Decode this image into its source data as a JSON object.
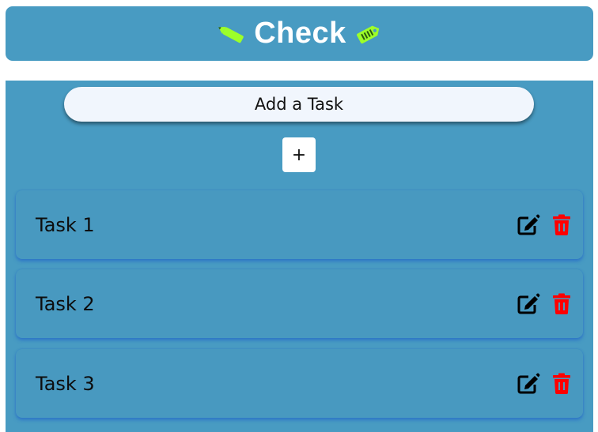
{
  "header": {
    "title": "Check",
    "left_icon": "pencil-icon",
    "right_icon": "tag-icon",
    "icon_color": "#9dff2a"
  },
  "form": {
    "input_placeholder": "Add a Task",
    "add_button_label": "+"
  },
  "tasks": [
    {
      "label": "Task 1",
      "edit_icon": "edit-icon",
      "delete_icon": "trash-icon"
    },
    {
      "label": "Task 2",
      "edit_icon": "edit-icon",
      "delete_icon": "trash-icon"
    },
    {
      "label": "Task 3",
      "edit_icon": "edit-icon",
      "delete_icon": "trash-icon"
    }
  ],
  "colors": {
    "primary": "#489bc2",
    "delete": "#ff0000",
    "edit": "#000000",
    "input_bg": "#f1f6fd"
  }
}
